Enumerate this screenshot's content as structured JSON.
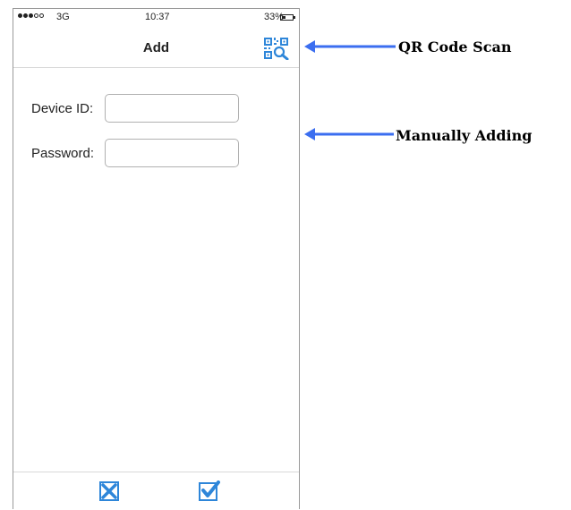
{
  "status_bar": {
    "carrier": "3G",
    "time": "10:37",
    "battery": "33%",
    "battery_level": 0.33,
    "signal_bars_filled": 3,
    "signal_bars_total": 5
  },
  "nav": {
    "title": "Add",
    "qr_icon": "qr-scan-icon"
  },
  "form": {
    "device_id_label": "Device ID:",
    "device_id_value": "",
    "password_label": "Password:",
    "password_value": ""
  },
  "toolbar": {
    "cancel_icon": "cancel-x-icon",
    "confirm_icon": "confirm-check-icon"
  },
  "annotations": {
    "qr": "QR Code Scan",
    "manual": "Manually Adding"
  },
  "colors": {
    "accent": "#2e86d9",
    "arrow": "#3b6ef0"
  }
}
